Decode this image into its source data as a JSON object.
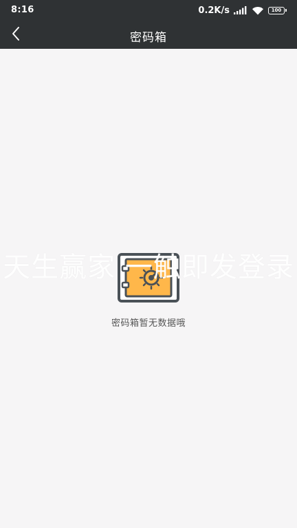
{
  "status_bar": {
    "time": "8:16",
    "net_speed": "0.2K/s",
    "battery": "100",
    "icons": [
      "signal-icon",
      "wifi-icon",
      "battery-icon"
    ]
  },
  "nav": {
    "title": "密码箱",
    "back_icon": "chevron-left-icon"
  },
  "empty_state": {
    "icon": "safe-icon",
    "message": "密码箱暂无数据哦"
  },
  "watermark": {
    "text": "天生赢家 一触即发登录"
  },
  "colors": {
    "bar_background": "#2f3234",
    "page_background": "#f6f5f6",
    "safe_accent": "#ffb74a",
    "safe_outline": "#4a5157"
  }
}
